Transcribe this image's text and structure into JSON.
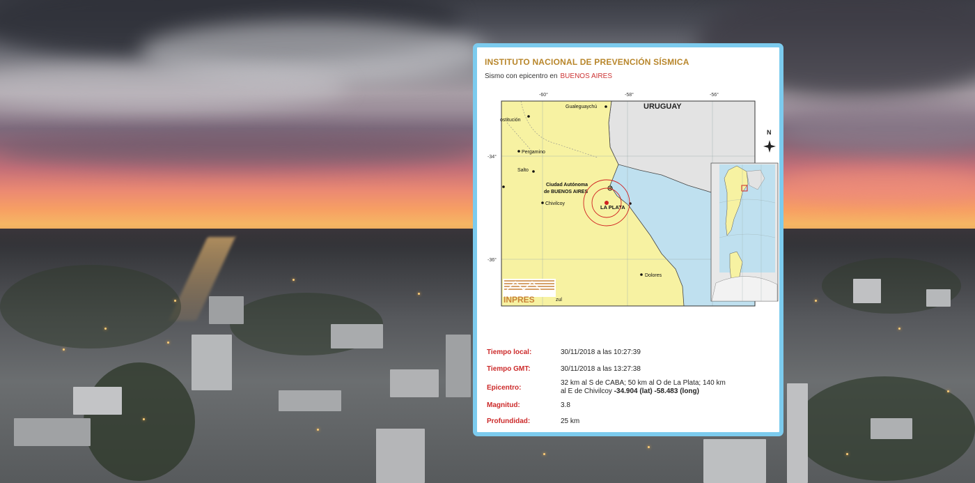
{
  "card": {
    "title": "INSTITUTO NACIONAL DE PREVENCIÓN SÍSMICA",
    "subtitle_prefix": "Sismo con epicentro en",
    "subtitle_place": "BUENOS AIRES"
  },
  "map": {
    "longitude_ticks": [
      "-60°",
      "-58°",
      "-56°"
    ],
    "latitude_ticks": [
      "-34°",
      "-36°"
    ],
    "country_label": "URUGUAY",
    "north_label": "N",
    "logo_text": "INPRES",
    "cities": [
      {
        "name": "Gualeguaychú"
      },
      {
        "name": "ostitución"
      },
      {
        "name": "Pergamino"
      },
      {
        "name": "Salto"
      },
      {
        "name": "Ciudad Autónoma"
      },
      {
        "name": "de BUENOS AIRES"
      },
      {
        "name": "Chivilcoy"
      },
      {
        "name": "LA PLATA"
      },
      {
        "name": "Dolores"
      },
      {
        "name": "zul"
      }
    ],
    "colors": {
      "land": "#f7f2a2",
      "neighbor": "#e3e3e3",
      "water": "#bfe0ef",
      "epicenter": "#d02020"
    }
  },
  "details": {
    "local_time_label": "Tiempo local:",
    "local_time_value": "30/11/2018 a las 10:27:39",
    "gmt_time_label": "Tiempo GMT:",
    "gmt_time_value": "30/11/2018 a las 13:27:38",
    "epicenter_label": "Epicentro:",
    "epicenter_text": "32 km al S de CABA; 50 km al O de La Plata; 140 km al E de Chivilcoy",
    "epicenter_lat": "-34.904 (lat)",
    "epicenter_long": "-58.483 (long)",
    "magnitude_label": "Magnitud:",
    "magnitude_value": "3.8",
    "depth_label": "Profundidad:",
    "depth_value": "25 km"
  }
}
